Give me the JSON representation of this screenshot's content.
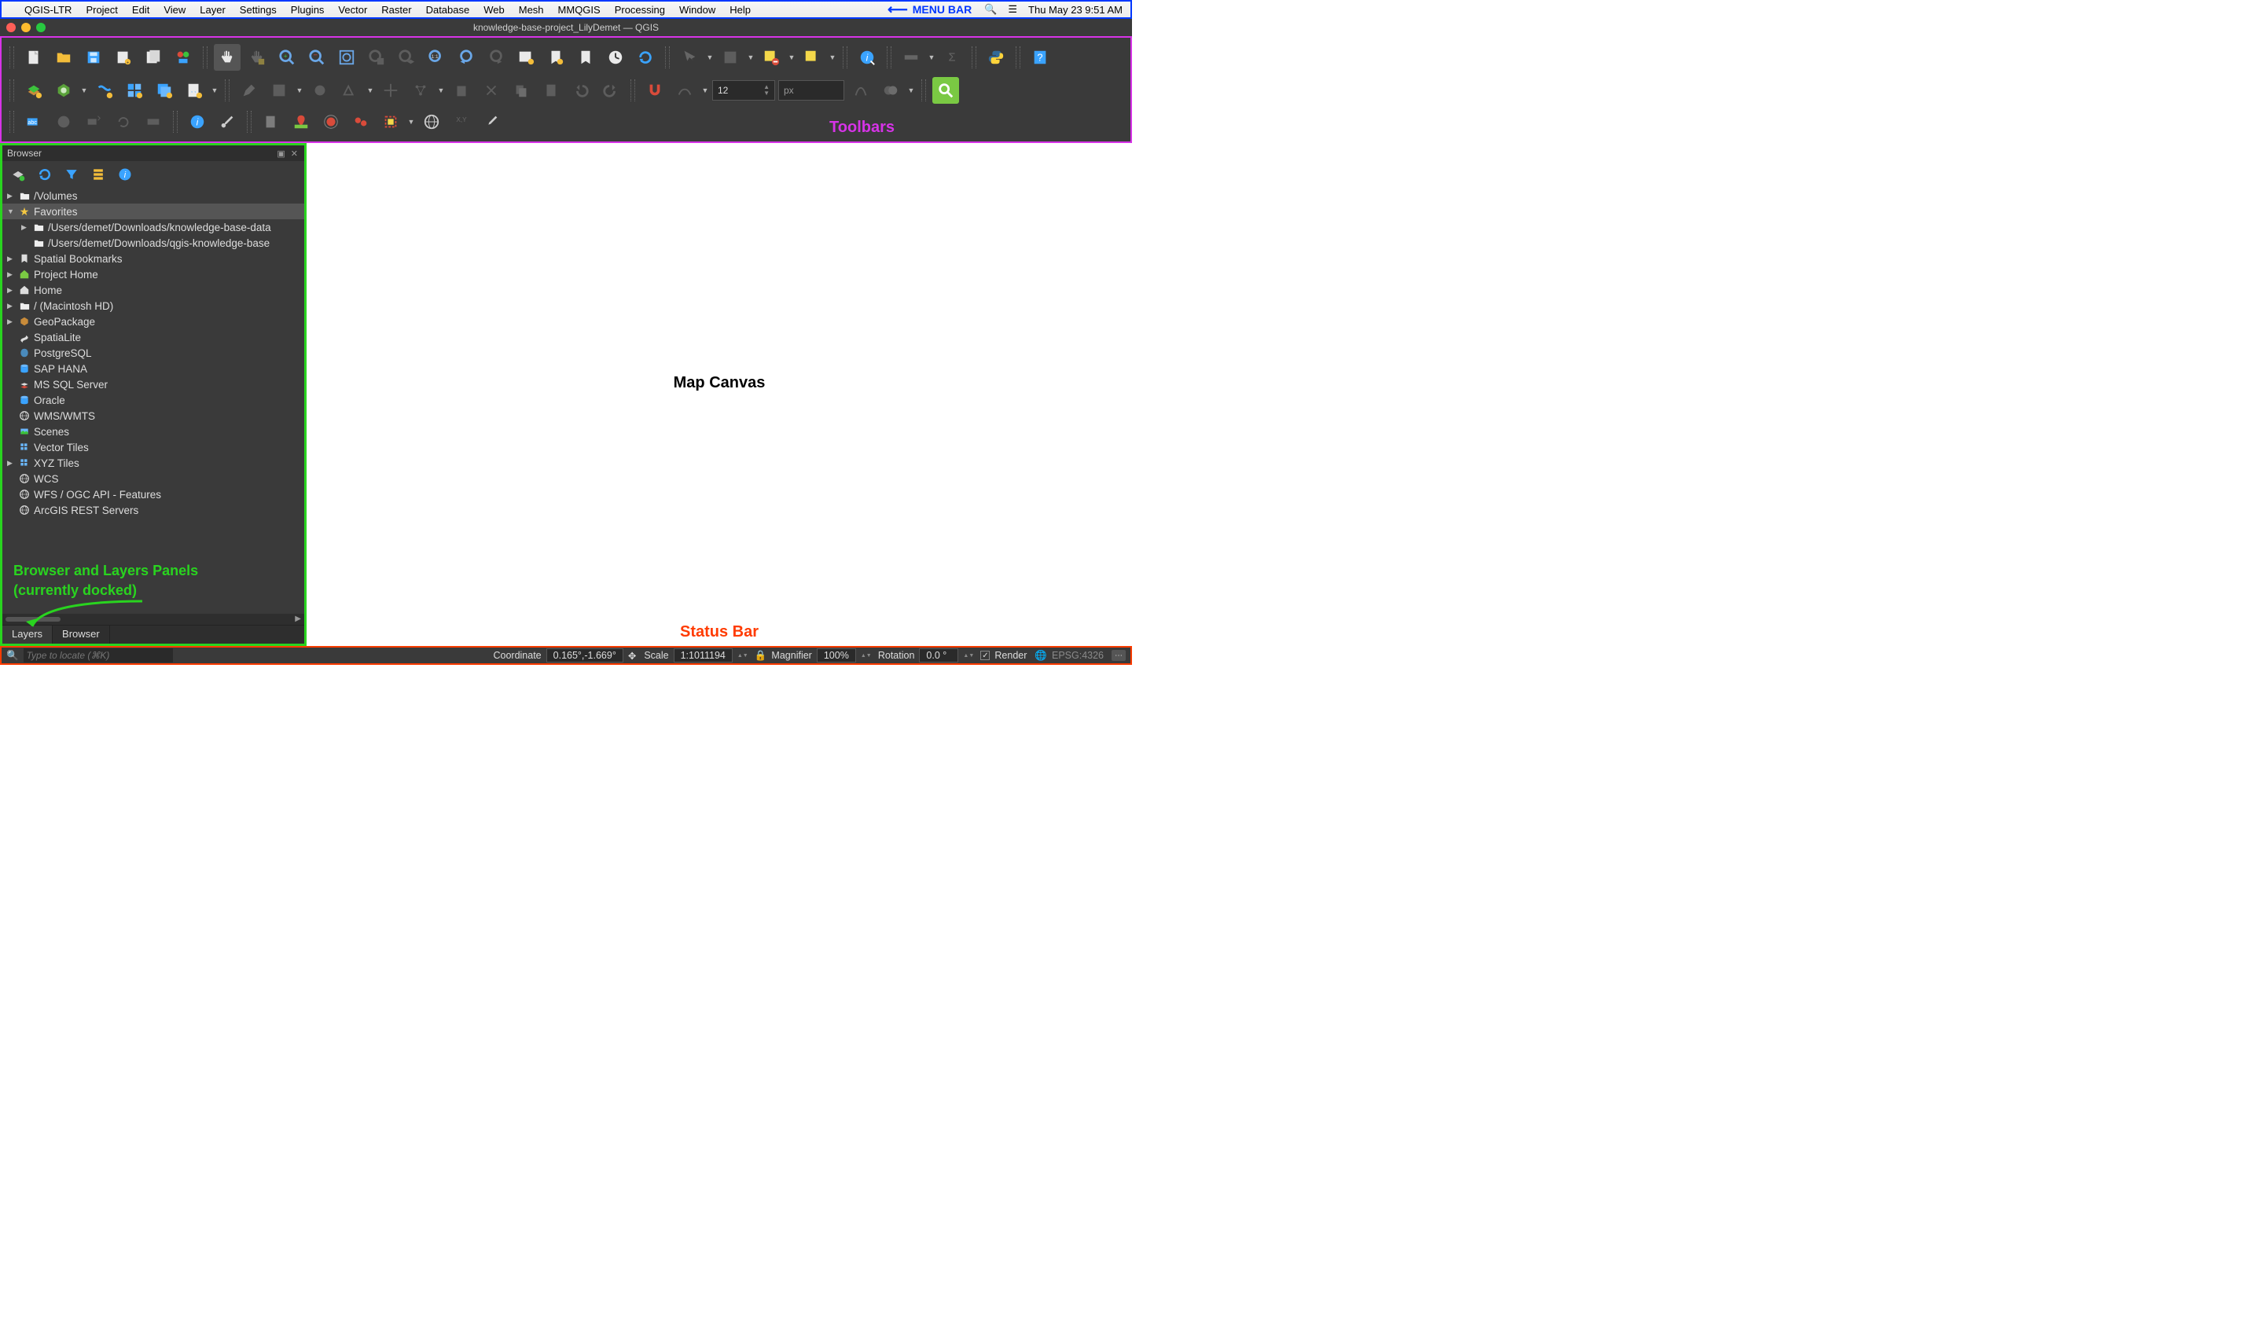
{
  "menubar": {
    "app": "QGIS-LTR",
    "items": [
      "Project",
      "Edit",
      "View",
      "Layer",
      "Settings",
      "Plugins",
      "Vector",
      "Raster",
      "Database",
      "Web",
      "Mesh",
      "MMQGIS",
      "Processing",
      "Window",
      "Help"
    ],
    "annotation": "MENU BAR",
    "datetime": "Thu May 23  9:51 AM"
  },
  "window": {
    "title": "knowledge-base-project_LilyDemet — QGIS"
  },
  "toolbars": {
    "annotation": "Toolbars",
    "size_value": "12",
    "size_unit": "px"
  },
  "browser": {
    "title": "Browser",
    "items": [
      {
        "indent": 0,
        "twisty": "▶",
        "icon": "folder",
        "label": "/Volumes"
      },
      {
        "indent": 0,
        "twisty": "▼",
        "icon": "star",
        "label": "Favorites",
        "selected": true
      },
      {
        "indent": 1,
        "twisty": "▶",
        "icon": "folder",
        "label": "/Users/demet/Downloads/knowledge-base-data"
      },
      {
        "indent": 1,
        "twisty": "",
        "icon": "folder",
        "label": "/Users/demet/Downloads/qgis-knowledge-base"
      },
      {
        "indent": 0,
        "twisty": "▶",
        "icon": "bookmark",
        "label": "Spatial Bookmarks"
      },
      {
        "indent": 0,
        "twisty": "▶",
        "icon": "home-green",
        "label": "Project Home"
      },
      {
        "indent": 0,
        "twisty": "▶",
        "icon": "home",
        "label": "Home"
      },
      {
        "indent": 0,
        "twisty": "▶",
        "icon": "folder",
        "label": "/ (Macintosh HD)"
      },
      {
        "indent": 0,
        "twisty": "▶",
        "icon": "geopackage",
        "label": "GeoPackage"
      },
      {
        "indent": 0,
        "twisty": "",
        "icon": "spatialite",
        "label": "SpatiaLite"
      },
      {
        "indent": 0,
        "twisty": "",
        "icon": "postgres",
        "label": "PostgreSQL"
      },
      {
        "indent": 0,
        "twisty": "",
        "icon": "db",
        "label": "SAP HANA"
      },
      {
        "indent": 0,
        "twisty": "",
        "icon": "mssql",
        "label": "MS SQL Server"
      },
      {
        "indent": 0,
        "twisty": "",
        "icon": "db",
        "label": "Oracle"
      },
      {
        "indent": 0,
        "twisty": "",
        "icon": "globe",
        "label": "WMS/WMTS"
      },
      {
        "indent": 0,
        "twisty": "",
        "icon": "scenes",
        "label": "Scenes"
      },
      {
        "indent": 0,
        "twisty": "",
        "icon": "tiles",
        "label": "Vector Tiles"
      },
      {
        "indent": 0,
        "twisty": "▶",
        "icon": "tiles",
        "label": "XYZ Tiles"
      },
      {
        "indent": 0,
        "twisty": "",
        "icon": "globe",
        "label": "WCS"
      },
      {
        "indent": 0,
        "twisty": "",
        "icon": "globe",
        "label": "WFS / OGC API - Features"
      },
      {
        "indent": 0,
        "twisty": "",
        "icon": "globe",
        "label": "ArcGIS REST Servers"
      }
    ],
    "annotation_line1": "Browser and Layers Panels",
    "annotation_line2": "(currently docked)",
    "tabs": [
      "Layers",
      "Browser"
    ]
  },
  "canvas": {
    "label": "Map Canvas",
    "annotation": "Status Bar"
  },
  "status": {
    "locator_placeholder": "Type to locate (⌘K)",
    "coordinate_label": "Coordinate",
    "coordinate_value": "0.165°,-1.669°",
    "scale_label": "Scale",
    "scale_value": "1:1011194",
    "magnifier_label": "Magnifier",
    "magnifier_value": "100%",
    "rotation_label": "Rotation",
    "rotation_value": "0.0 °",
    "render_label": "Render",
    "crs": "EPSG:4326"
  },
  "colors": {
    "menubar_border": "#0037ff",
    "toolbars_border": "#d733e8",
    "panel_border": "#29d41f",
    "status_border": "#ff3b00"
  }
}
